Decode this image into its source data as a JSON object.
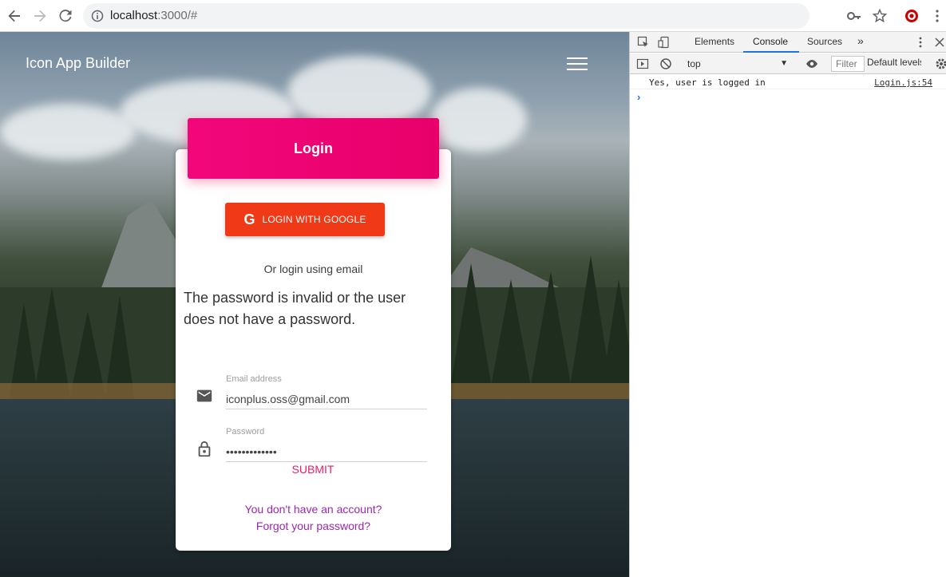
{
  "browser": {
    "url_host": "localhost",
    "url_rest": ":3000/#",
    "icons": [
      "back-arrow-icon",
      "forward-arrow-icon",
      "reload-icon",
      "info-icon",
      "key-icon",
      "star-icon",
      "target-extension-icon",
      "more-vert-icon"
    ]
  },
  "app": {
    "title": "Icon App Builder",
    "login": {
      "header": "Login",
      "google_button": "LOGIN WITH GOOGLE",
      "or_text": "Or login using email",
      "error": "The password is invalid or the user does not have a password.",
      "email_label": "Email address",
      "email_value": "iconplus.oss@gmail.com",
      "password_label": "Password",
      "password_value": "•••••••••••••",
      "submit": "SUBMIT",
      "signup_link": "You don't have an account?",
      "forgot_link": "Forgot your password?"
    },
    "colors": {
      "primary": "#e91e63",
      "google": "#f03a17",
      "link": "#9c27b0"
    }
  },
  "devtools": {
    "tabs": [
      "Elements",
      "Console",
      "Sources"
    ],
    "active_tab": "Console",
    "more_tabs": "»",
    "context": "top",
    "filter_placeholder": "Filter",
    "levels": "Default levels",
    "console": {
      "message": "Yes, user is logged in",
      "source": "Login.js:54",
      "prompt": "›"
    }
  }
}
